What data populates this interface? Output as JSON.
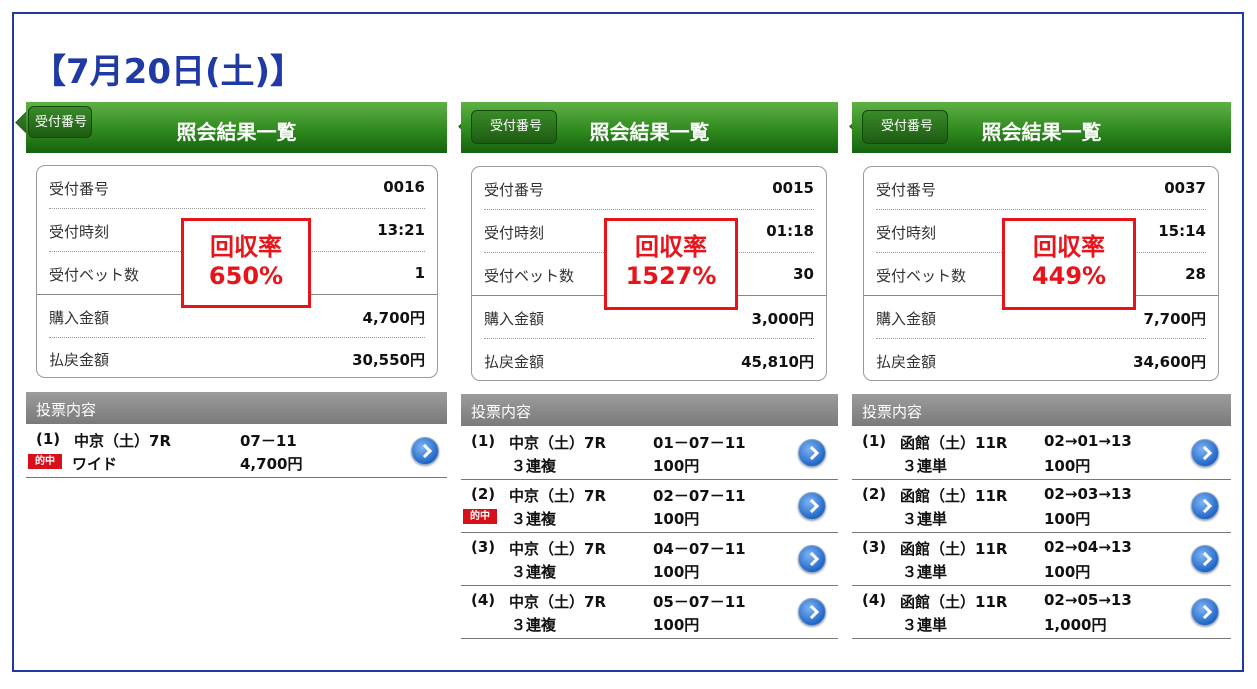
{
  "page_title": "【7月20日(土)】",
  "panels": [
    {
      "header": {
        "back_label": "受付番号",
        "title": "照会結果一覧"
      },
      "card": {
        "rows": [
          {
            "label": "受付番号",
            "value": "0016"
          },
          {
            "label": "受付時刻",
            "value": "13:21"
          },
          {
            "label": "受付ベット数",
            "value": "1"
          },
          {
            "label": "購入金額",
            "value": "4,700円"
          },
          {
            "label": "払戻金額",
            "value": "30,550円"
          }
        ]
      },
      "recovery": {
        "line1": "回収率",
        "line2": "650%"
      },
      "section_label": "投票内容",
      "bets": [
        {
          "num": "(1)",
          "place": "中京（土）7R",
          "combo": "07－11",
          "type": "ワイド",
          "amount": "4,700円",
          "hit": "的中"
        }
      ]
    },
    {
      "header": {
        "back_label": "受付番号",
        "title": "照会結果一覧"
      },
      "card": {
        "rows": [
          {
            "label": "受付番号",
            "value": "0015"
          },
          {
            "label": "受付時刻",
            "value": "01:18"
          },
          {
            "label": "受付ベット数",
            "value": "30"
          },
          {
            "label": "購入金額",
            "value": "3,000円"
          },
          {
            "label": "払戻金額",
            "value": "45,810円"
          }
        ]
      },
      "recovery": {
        "line1": "回収率",
        "line2": "1527%"
      },
      "section_label": "投票内容",
      "bets": [
        {
          "num": "(1)",
          "place": "中京（土）7R",
          "combo": "01－07－11",
          "type": "３連複",
          "amount": "100円"
        },
        {
          "num": "(2)",
          "place": "中京（土）7R",
          "combo": "02－07－11",
          "type": "３連複",
          "amount": "100円",
          "hit": "的中"
        },
        {
          "num": "(3)",
          "place": "中京（土）7R",
          "combo": "04－07－11",
          "type": "３連複",
          "amount": "100円"
        },
        {
          "num": "(4)",
          "place": "中京（土）7R",
          "combo": "05－07－11",
          "type": "３連複",
          "amount": "100円"
        }
      ]
    },
    {
      "header": {
        "back_label": "受付番号",
        "title": "照会結果一覧"
      },
      "card": {
        "rows": [
          {
            "label": "受付番号",
            "value": "0037"
          },
          {
            "label": "受付時刻",
            "value": "15:14"
          },
          {
            "label": "受付ベット数",
            "value": "28"
          },
          {
            "label": "購入金額",
            "value": "7,700円"
          },
          {
            "label": "払戻金額",
            "value": "34,600円"
          }
        ]
      },
      "recovery": {
        "line1": "回収率",
        "line2": "449%"
      },
      "section_label": "投票内容",
      "bets": [
        {
          "num": "(1)",
          "place": "函館（土）11R",
          "combo": "02→01→13",
          "type": "３連単",
          "amount": "100円"
        },
        {
          "num": "(2)",
          "place": "函館（土）11R",
          "combo": "02→03→13",
          "type": "３連単",
          "amount": "100円"
        },
        {
          "num": "(3)",
          "place": "函館（土）11R",
          "combo": "02→04→13",
          "type": "３連単",
          "amount": "100円"
        },
        {
          "num": "(4)",
          "place": "函館（土）11R",
          "combo": "02→05→13",
          "type": "３連単",
          "amount": "1,000円"
        }
      ]
    }
  ]
}
